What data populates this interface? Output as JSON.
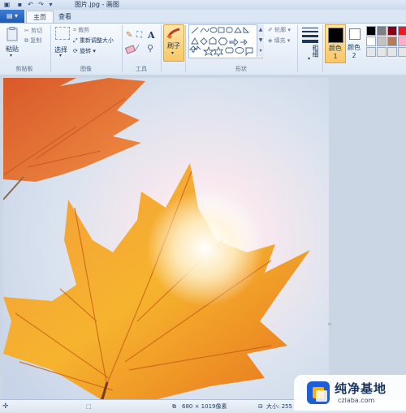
{
  "window": {
    "title": "图片.jpg - 画图"
  },
  "menu": {
    "app_button": "▤ ▾"
  },
  "tabs": [
    {
      "label": "主页",
      "active": true
    },
    {
      "label": "查看",
      "active": false
    }
  ],
  "clipboard": {
    "paste": "粘贴",
    "cut": "剪切",
    "copy": "复制",
    "group": "剪贴板"
  },
  "image_group": {
    "select": "选择",
    "crop": "裁剪",
    "resize": "重新调整大小",
    "rotate": "旋转",
    "group": "图像"
  },
  "tools": {
    "group": "工具",
    "text_icon": "A"
  },
  "brushes": {
    "label": "刷子"
  },
  "shapes": {
    "outline": "轮廓",
    "fill": "填充",
    "group": "形状"
  },
  "size": {
    "label": "粗细"
  },
  "colors": {
    "color1": "颜色 1",
    "color2": "颜色 2",
    "color1_value": "#000000",
    "color2_value": "#ffffff",
    "palette": [
      "#000000",
      "#7f7f7f",
      "#880015",
      "#ed1c24",
      "#ffffff",
      "#c3c3c3",
      "#b97a57",
      "#ffaec9",
      "#e6e6e6",
      "#e6e6e6",
      "#e6e6e6",
      "#e6e6e6"
    ]
  },
  "status": {
    "dimensions": "680 × 1019像素",
    "size": "大小: 255"
  },
  "watermark": {
    "title": "纯净基地",
    "url": "czlaba.com"
  }
}
